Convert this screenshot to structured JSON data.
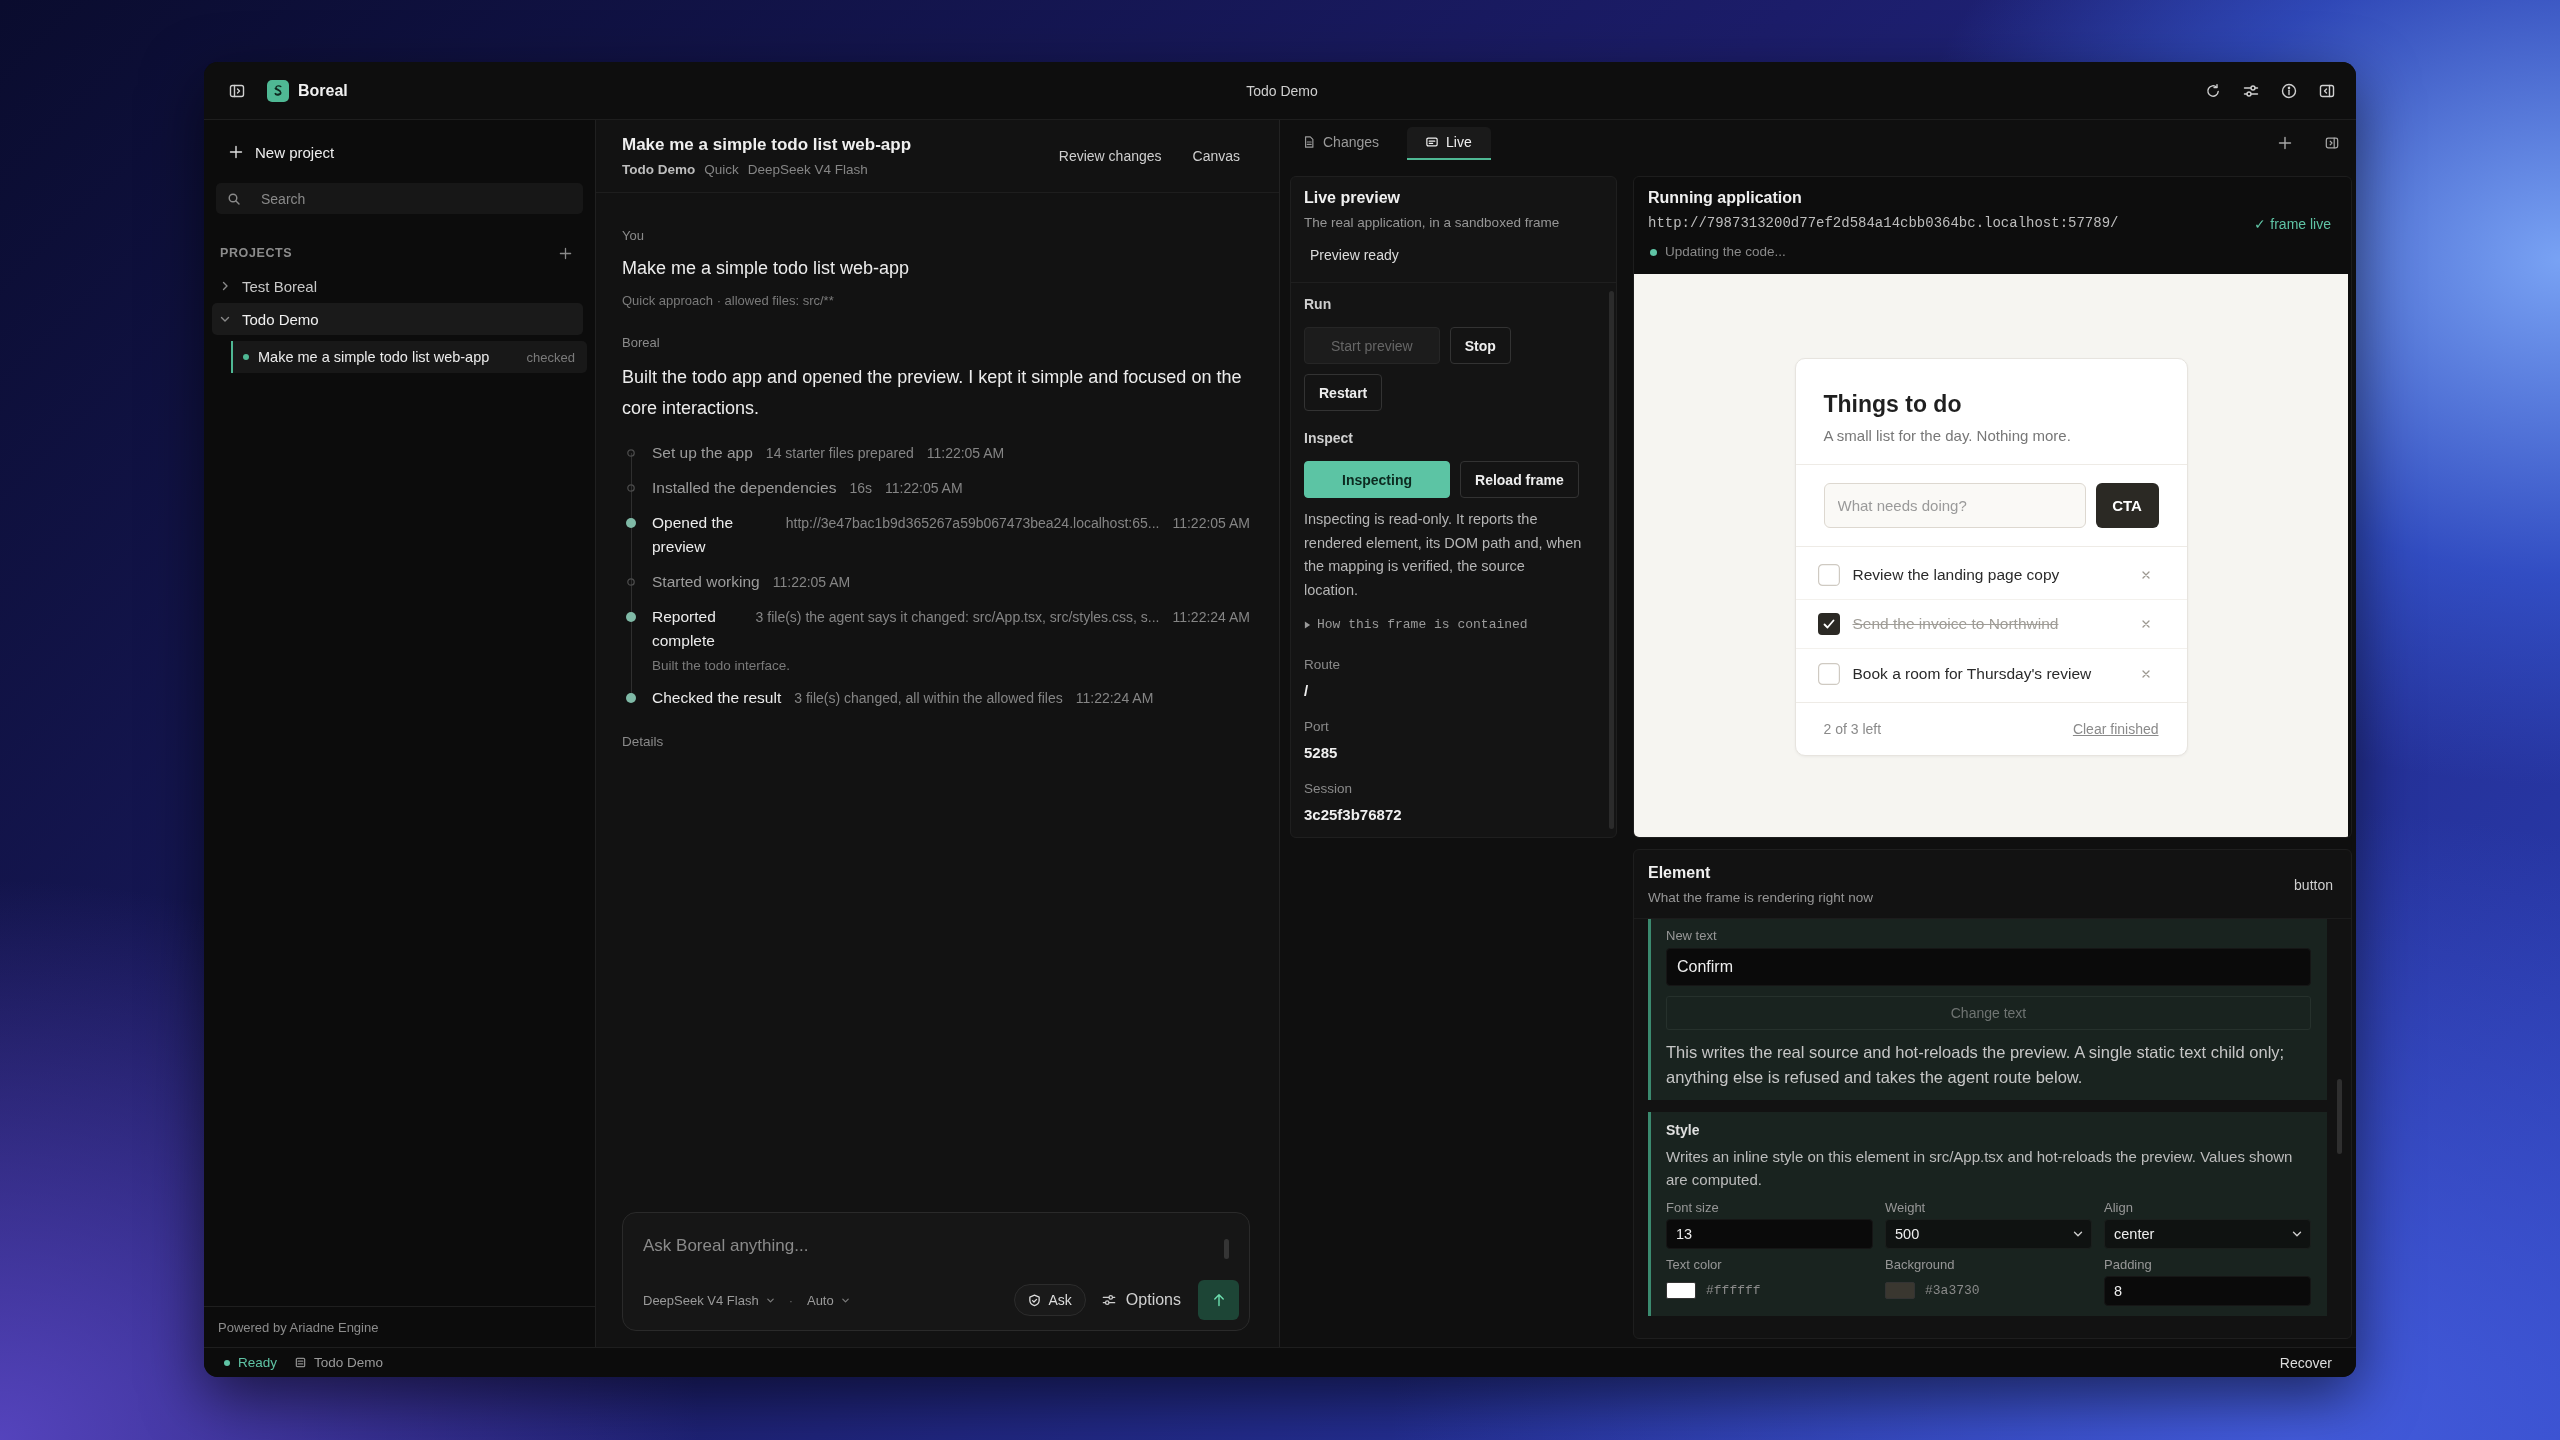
{
  "window": {
    "title": "Todo Demo"
  },
  "app": {
    "name": "Boreal"
  },
  "sidebar": {
    "new_project": "New project",
    "search": {
      "placeholder": "Search"
    },
    "section_title": "PROJECTS",
    "projects": [
      {
        "name": "Test Boreal",
        "expanded": false,
        "selected": false
      },
      {
        "name": "Todo Demo",
        "expanded": true,
        "selected": true,
        "children": [
          {
            "title": "Make me a simple todo list web-app",
            "status": "checked",
            "selected": true
          }
        ]
      }
    ],
    "footer": "Powered by Ariadne Engine"
  },
  "chat": {
    "title": "Make me a simple todo list web-app",
    "meta": [
      "Todo Demo",
      "Quick",
      "DeepSeek V4 Flash"
    ],
    "actions": [
      "Review changes",
      "Canvas"
    ],
    "messages": [
      {
        "kind": "user",
        "author": "You",
        "text": "Make me a simple todo list web-app",
        "note": "Quick approach · allowed files: src/**"
      },
      {
        "kind": "agent",
        "author": "Boreal",
        "text": "Built the todo app and opened the preview. I kept it simple and focused on the core interactions.",
        "steps": [
          {
            "kind": "step",
            "title": "Set up the app",
            "detail": "14 starter files prepared",
            "time": "11:22:05 AM"
          },
          {
            "kind": "step",
            "title": "Installed the dependencies",
            "detail": "16s",
            "time": "11:22:05 AM"
          },
          {
            "kind": "milestone",
            "title": "Opened the preview",
            "detail": "http://3e47bac1b9d365267a59b067473bea24.localhost:65...",
            "time": "11:22:05 AM"
          },
          {
            "kind": "step",
            "title": "Started working",
            "time": "11:22:05 AM"
          },
          {
            "kind": "milestone",
            "title": "Reported complete",
            "detail": "3 file(s) the agent says it changed: src/App.tsx, src/styles.css, s...",
            "time": "11:22:24 AM",
            "note": "Built the todo interface."
          },
          {
            "kind": "milestone",
            "title": "Checked the result",
            "detail": "3 file(s) changed, all within the allowed files",
            "time": "11:22:24 AM"
          }
        ],
        "link": "Details"
      }
    ],
    "composer": {
      "placeholder": "Ask Boreal anything...",
      "model": "DeepSeek V4 Flash",
      "separator": "·",
      "mode": "Auto",
      "ask": "Ask",
      "options": "Options"
    }
  },
  "workspace": {
    "tabs": [
      {
        "label": "Changes",
        "selected": false
      },
      {
        "label": "Live",
        "selected": true
      }
    ],
    "live_preview": {
      "title": "Live preview",
      "subtitle": "The real application, in a sandboxed frame",
      "status": "Preview ready",
      "run": {
        "label": "Run",
        "buttons": [
          {
            "label": "Start preview",
            "disabled": true
          },
          {
            "label": "Stop",
            "disabled": false
          },
          {
            "label": "Restart",
            "disabled": false
          }
        ]
      },
      "inspect": {
        "label": "Inspect",
        "toggle": {
          "label": "Inspecting",
          "on": true
        },
        "reload": "Reload frame",
        "description": "Inspecting is read-only. It reports the rendered element, its DOM path and, when the mapping is verified, the source location."
      },
      "disclosure": {
        "label": "How this frame is contained",
        "expanded": false
      },
      "fields": [
        {
          "label": "Route",
          "value": "/"
        },
        {
          "label": "Port",
          "value": "5285"
        },
        {
          "label": "Session",
          "value": "3c25f3b76872"
        }
      ]
    },
    "running_app": {
      "title": "Running application",
      "url": "http://7987313200d77ef2d584a14cbb0364bc.localhost:57789/",
      "status": "Updating the code...",
      "frame_state": "✓ frame live",
      "frame": {
        "title": "Things to do",
        "subtitle": "A small list for the day. Nothing more.",
        "input": {
          "placeholder": "What needs doing?"
        },
        "button": "CTA",
        "todos": [
          {
            "text": "Review the landing page copy",
            "checked": false
          },
          {
            "text": "Send the invoice to Northwind",
            "checked": true
          },
          {
            "text": "Book a room for Thursday's review",
            "checked": false
          }
        ],
        "count": "2 of 3 left",
        "clear": "Clear finished"
      }
    },
    "element": {
      "title": "Element",
      "subtitle": "What the frame is rendering right now",
      "tag": "button",
      "text_edit": {
        "label": "New text",
        "value": "Confirm",
        "button": {
          "label": "Change text",
          "disabled": true
        },
        "note": "This writes the real source and hot-reloads the preview. A single static text child only; anything else is refused and takes the agent route below."
      },
      "style": {
        "title": "Style",
        "description": "Writes an inline style on this element in src/App.tsx and hot-reloads the preview. Values shown are computed.",
        "fields": [
          {
            "label": "Font size",
            "kind": "input",
            "value": "13"
          },
          {
            "label": "Weight",
            "kind": "select",
            "value": "500"
          },
          {
            "label": "Align",
            "kind": "select",
            "value": "center"
          },
          {
            "label": "Text color",
            "kind": "color",
            "value": "#ffffff"
          },
          {
            "label": "Background",
            "kind": "color",
            "value": "#3a3730"
          },
          {
            "label": "Padding",
            "kind": "input",
            "value": "8"
          }
        ]
      }
    }
  },
  "status_bar": {
    "state": "Ready",
    "project": "Todo Demo",
    "action": "Recover"
  }
}
